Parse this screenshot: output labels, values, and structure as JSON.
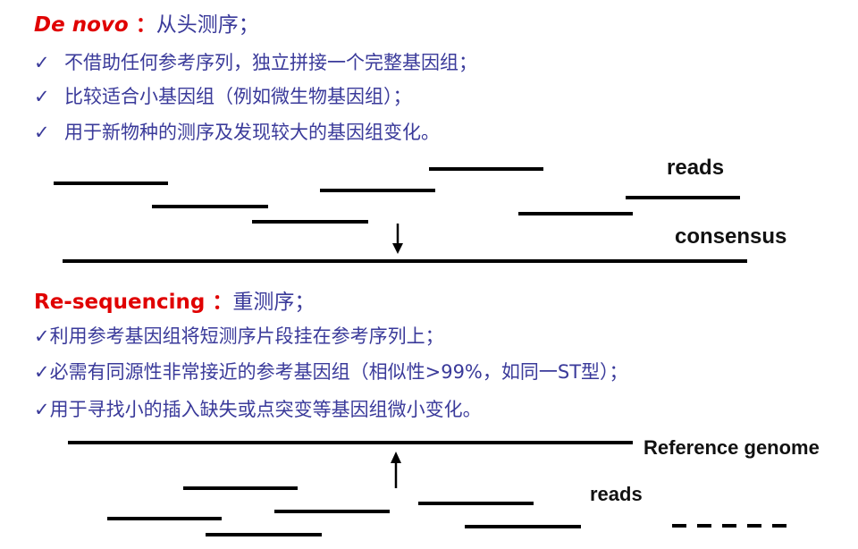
{
  "denovo": {
    "title": "De novo",
    "colon": "：",
    "subtitle": "从头测序；",
    "check": "✓",
    "bullets": [
      "不借助任何参考序列，独立拼接一个完整基因组；",
      "比较适合小基因组（例如微生物基因组）；",
      "用于新物种的测序及发现较大的基因组变化。"
    ],
    "reads_label": "reads",
    "consensus_label": "consensus"
  },
  "reseq": {
    "title": "Re-sequencing",
    "colon": "：",
    "subtitle": "重测序；",
    "check": "✓",
    "bullets": [
      "利用参考基因组将短测序片段挂在参考序列上；",
      "必需有同源性非常接近的参考基因组（相似性>99%，如同一ST型）；",
      "用于寻找小的插入缺失或点突变等基因组微小变化。"
    ],
    "reference_label": "Reference genome",
    "reads_label": "reads"
  },
  "colors": {
    "title": "#e00000",
    "text": "#3a3a9a",
    "lines": "#000000"
  }
}
